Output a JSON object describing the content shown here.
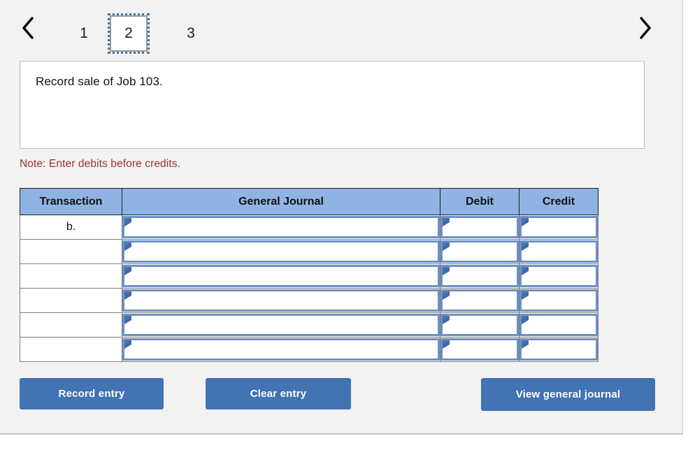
{
  "pager": {
    "prev_icon": "chevron-left-icon",
    "next_icon": "chevron-right-icon",
    "prev_label": "‹",
    "next_label": "›",
    "pages": [
      {
        "label": "1",
        "selected": false
      },
      {
        "label": "2",
        "selected": true
      },
      {
        "label": "3",
        "selected": false
      }
    ]
  },
  "prompt": {
    "text": "Record sale of Job 103."
  },
  "note": {
    "text": "Note: Enter debits before credits."
  },
  "table": {
    "headers": [
      "Transaction",
      "General Journal",
      "Debit",
      "Credit"
    ],
    "rows": [
      {
        "transaction": "b.",
        "general_journal": "",
        "debit": "",
        "credit": ""
      },
      {
        "transaction": "",
        "general_journal": "",
        "debit": "",
        "credit": ""
      },
      {
        "transaction": "",
        "general_journal": "",
        "debit": "",
        "credit": ""
      },
      {
        "transaction": "",
        "general_journal": "",
        "debit": "",
        "credit": ""
      },
      {
        "transaction": "",
        "general_journal": "",
        "debit": "",
        "credit": ""
      },
      {
        "transaction": "",
        "general_journal": "",
        "debit": "",
        "credit": ""
      }
    ]
  },
  "buttons": {
    "record": "Record entry",
    "clear": "Clear entry",
    "view": "View general journal"
  },
  "colors": {
    "page_background": "#f2f2f2",
    "header_blue": "#8fb4e3",
    "button_blue": "#4273b3",
    "note_red": "#9c3030",
    "input_border_blue": "#6d92c4",
    "marker_blue": "#3f6aa8"
  }
}
